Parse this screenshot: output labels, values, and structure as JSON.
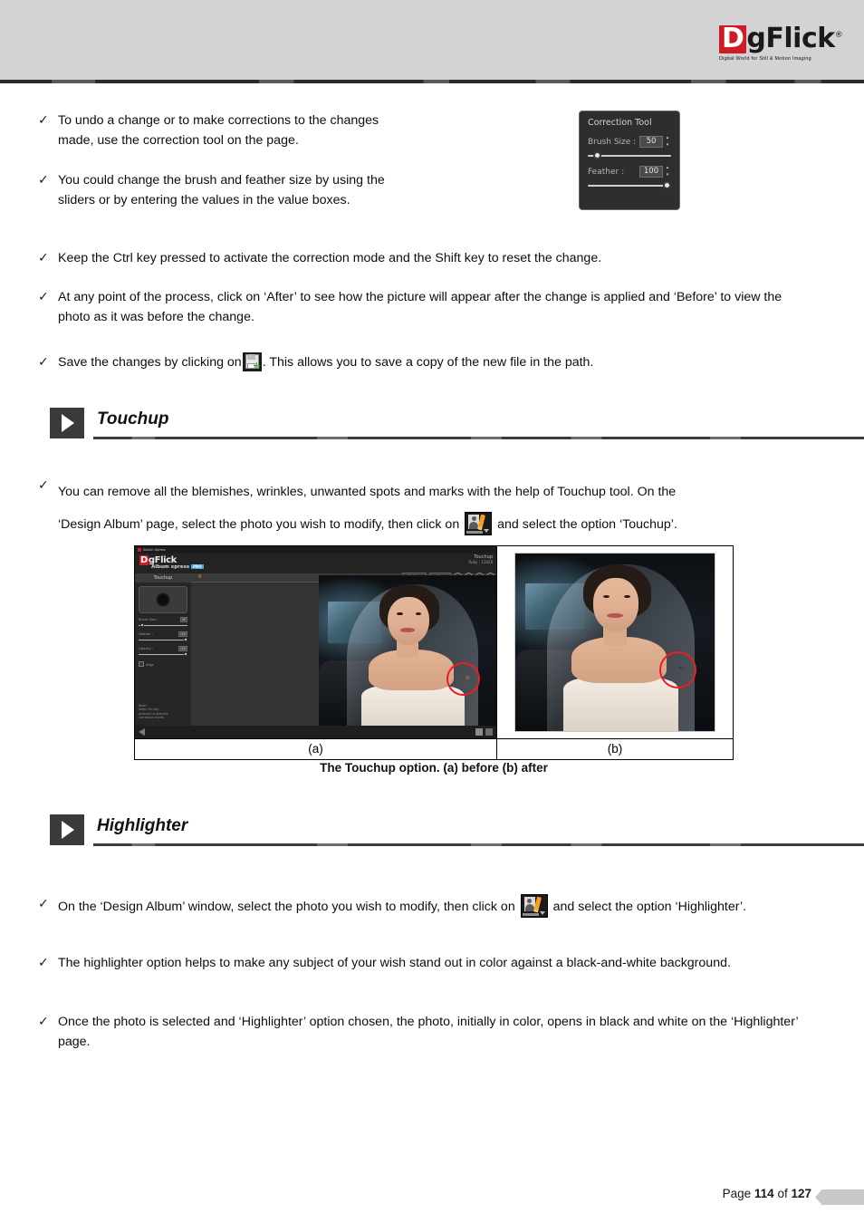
{
  "header": {
    "logo_d": "D",
    "logo_rest": "gFlick",
    "logo_registered": "®",
    "logo_tagline": "Digital World for Still & Motion Imaging"
  },
  "bullets_top": [
    {
      "tick": "✓",
      "text": "To undo a change or to make corrections to the changes made, use the correction tool on the page."
    },
    {
      "tick": "✓",
      "text": "You could change the brush and feather size by using the sliders or by entering the values in the value boxes."
    },
    {
      "tick": "✓",
      "text": "Keep the Ctrl key pressed to activate the correction mode and the Shift key to reset the change."
    },
    {
      "tick": "✓",
      "text": "At any point of the process, click on ‘After’ to see how the picture will appear after the change is applied and ‘Before’ to view the photo as it was before the change."
    }
  ],
  "save_bullet": {
    "tick": "✓",
    "before": " Save the changes by clicking on",
    "after": ". This allows you to save a copy of the new file in the path."
  },
  "correction_tool": {
    "title": "Correction Tool",
    "brush_label": "Brush Size :",
    "brush_value": "50",
    "feather_label": "Feather :",
    "feather_value": "100",
    "spin_up": "▴",
    "spin_down": "▾"
  },
  "sections": {
    "touchup": {
      "title": "Touchup",
      "icon": "play-triangle"
    },
    "highlighter": {
      "title": "Highlighter",
      "icon": "play-triangle"
    }
  },
  "touchup_bullet": {
    "tick": "✓",
    "line1": "You can remove all the blemishes, wrinkles, unwanted spots and marks with the help of Touchup tool. On the",
    "line2_before": "‘Design Album’ page, select the photo you wish to modify, then click on",
    "line2_after": "and select the option ‘Touchup’."
  },
  "figure": {
    "caption_a": "(a)",
    "caption_b": "(b)",
    "caption": "The Touchup option. (a) before (b) after",
    "app": {
      "window_title": "Album Xpress",
      "brand_d": "D",
      "brand_rest": "gFlick",
      "brand_sub": "Album xpress",
      "brand_pill": "PRO",
      "tab_label": "Touchup",
      "page_number": "9",
      "mode_label": "Touchup",
      "ruby_label": "Ruby : 12828",
      "before_button": "Before",
      "after_button": "After",
      "brush_size_label": "Brush Size :",
      "brush_size_value": "30",
      "feather_label": "Feather :",
      "feather_value": "100",
      "opacity_label": "Opacity :",
      "opacity_value": "100",
      "align_label": "Align",
      "note": "Note :\nKeep Ctrl key\npressed to activate\ncorrection mode."
    }
  },
  "highlighter_bullets": {
    "b1": {
      "tick": "✓",
      "before": "On the ‘Design Album’ window, select the photo you wish to modify, then click on",
      "after": "and select the option ‘Highlighter’."
    },
    "b2": {
      "tick": "✓",
      "text": "The highlighter option helps to make any subject of your wish stand out in color against a black-and-white background."
    },
    "b3": {
      "tick": "✓",
      "text": "Once the photo is selected and ‘Highlighter’ option chosen, the photo, initially in color, opens in black and white on the ‘Highlighter’ page."
    }
  },
  "footer": {
    "page_word": "Page",
    "page_number": "114",
    "of_word": "of",
    "total_pages": "127"
  },
  "colors": {
    "brand_red": "#d11a28",
    "header_gray": "#d3d3d3",
    "annotation_red": "#ee1c24",
    "accent_orange": "#f6a01b"
  }
}
